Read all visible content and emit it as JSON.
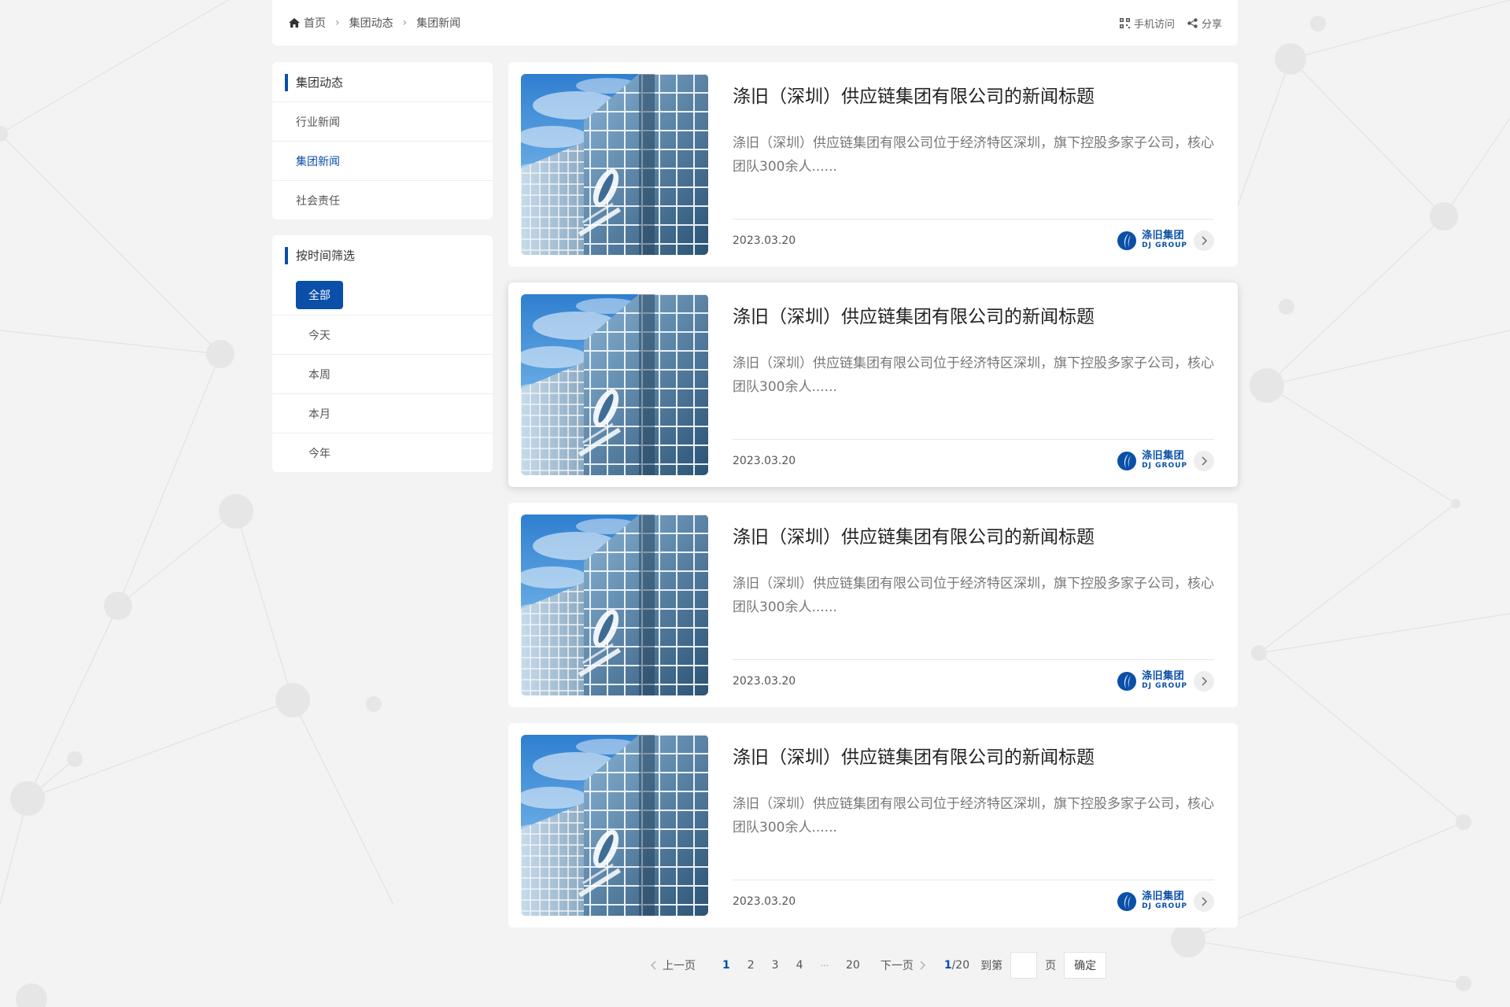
{
  "breadcrumb": {
    "home": "首页",
    "level1": "集团动态",
    "level2": "集团新闻"
  },
  "tools": {
    "mobile": "手机访问",
    "share": "分享"
  },
  "sidebar": {
    "category_title": "集团动态",
    "items": [
      {
        "label": "行业新闻"
      },
      {
        "label": "集团新闻"
      },
      {
        "label": "社会责任"
      }
    ],
    "active_index": 1,
    "filter_title": "按时间筛选",
    "filter_all": "全部",
    "filters": [
      {
        "label": "今天"
      },
      {
        "label": "本周"
      },
      {
        "label": "本月"
      },
      {
        "label": "今年"
      }
    ]
  },
  "articles": [
    {
      "title": "涤旧（深圳）供应链集团有限公司的新闻标题",
      "summary": "涤旧（深圳）供应链集团有限公司位于经济特区深圳，旗下控股多家子公司，核心团队300余人......",
      "date": "2023.03.20",
      "logo_cn": "涤旧集团",
      "logo_en": "DJ GROUP"
    },
    {
      "title": "涤旧（深圳）供应链集团有限公司的新闻标题",
      "summary": "涤旧（深圳）供应链集团有限公司位于经济特区深圳，旗下控股多家子公司，核心团队300余人......",
      "date": "2023.03.20",
      "logo_cn": "涤旧集团",
      "logo_en": "DJ GROUP"
    },
    {
      "title": "涤旧（深圳）供应链集团有限公司的新闻标题",
      "summary": "涤旧（深圳）供应链集团有限公司位于经济特区深圳，旗下控股多家子公司，核心团队300余人......",
      "date": "2023.03.20",
      "logo_cn": "涤旧集团",
      "logo_en": "DJ GROUP"
    },
    {
      "title": "涤旧（深圳）供应链集团有限公司的新闻标题",
      "summary": "涤旧（深圳）供应链集团有限公司位于经济特区深圳，旗下控股多家子公司，核心团队300余人......",
      "date": "2023.03.20",
      "logo_cn": "涤旧集团",
      "logo_en": "DJ GROUP"
    }
  ],
  "pagination": {
    "prev": "上一页",
    "next": "下一页",
    "pages": [
      "1",
      "2",
      "3",
      "4",
      "···",
      "20"
    ],
    "current": "1",
    "total": "/20",
    "goto_prefix": "到第",
    "goto_suffix": "页",
    "goto_value": "",
    "confirm": "确定"
  },
  "colors": {
    "accent": "#0a4fa8",
    "background": "#f3f3f4"
  }
}
